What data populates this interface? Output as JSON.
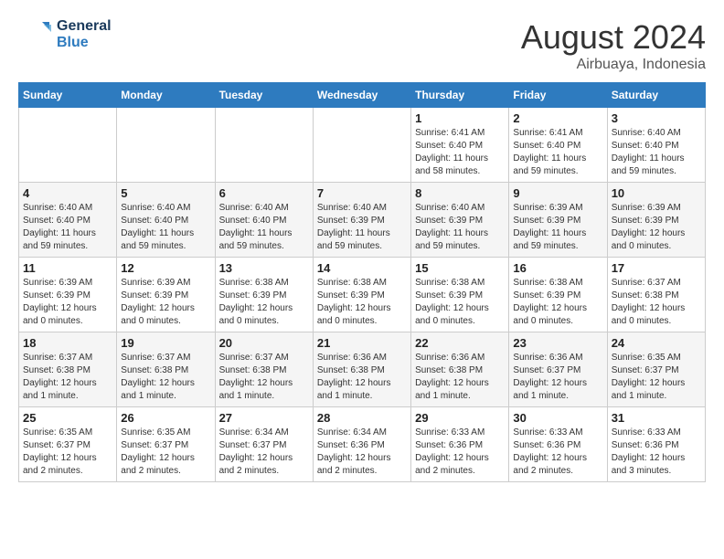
{
  "logo": {
    "line1": "General",
    "line2": "Blue"
  },
  "title": "August 2024",
  "location": "Airbuaya, Indonesia",
  "headers": [
    "Sunday",
    "Monday",
    "Tuesday",
    "Wednesday",
    "Thursday",
    "Friday",
    "Saturday"
  ],
  "weeks": [
    [
      {
        "day": "",
        "info": ""
      },
      {
        "day": "",
        "info": ""
      },
      {
        "day": "",
        "info": ""
      },
      {
        "day": "",
        "info": ""
      },
      {
        "day": "1",
        "info": "Sunrise: 6:41 AM\nSunset: 6:40 PM\nDaylight: 11 hours and 58 minutes."
      },
      {
        "day": "2",
        "info": "Sunrise: 6:41 AM\nSunset: 6:40 PM\nDaylight: 11 hours and 59 minutes."
      },
      {
        "day": "3",
        "info": "Sunrise: 6:40 AM\nSunset: 6:40 PM\nDaylight: 11 hours and 59 minutes."
      }
    ],
    [
      {
        "day": "4",
        "info": "Sunrise: 6:40 AM\nSunset: 6:40 PM\nDaylight: 11 hours and 59 minutes."
      },
      {
        "day": "5",
        "info": "Sunrise: 6:40 AM\nSunset: 6:40 PM\nDaylight: 11 hours and 59 minutes."
      },
      {
        "day": "6",
        "info": "Sunrise: 6:40 AM\nSunset: 6:40 PM\nDaylight: 11 hours and 59 minutes."
      },
      {
        "day": "7",
        "info": "Sunrise: 6:40 AM\nSunset: 6:39 PM\nDaylight: 11 hours and 59 minutes."
      },
      {
        "day": "8",
        "info": "Sunrise: 6:40 AM\nSunset: 6:39 PM\nDaylight: 11 hours and 59 minutes."
      },
      {
        "day": "9",
        "info": "Sunrise: 6:39 AM\nSunset: 6:39 PM\nDaylight: 11 hours and 59 minutes."
      },
      {
        "day": "10",
        "info": "Sunrise: 6:39 AM\nSunset: 6:39 PM\nDaylight: 12 hours and 0 minutes."
      }
    ],
    [
      {
        "day": "11",
        "info": "Sunrise: 6:39 AM\nSunset: 6:39 PM\nDaylight: 12 hours and 0 minutes."
      },
      {
        "day": "12",
        "info": "Sunrise: 6:39 AM\nSunset: 6:39 PM\nDaylight: 12 hours and 0 minutes."
      },
      {
        "day": "13",
        "info": "Sunrise: 6:38 AM\nSunset: 6:39 PM\nDaylight: 12 hours and 0 minutes."
      },
      {
        "day": "14",
        "info": "Sunrise: 6:38 AM\nSunset: 6:39 PM\nDaylight: 12 hours and 0 minutes."
      },
      {
        "day": "15",
        "info": "Sunrise: 6:38 AM\nSunset: 6:39 PM\nDaylight: 12 hours and 0 minutes."
      },
      {
        "day": "16",
        "info": "Sunrise: 6:38 AM\nSunset: 6:39 PM\nDaylight: 12 hours and 0 minutes."
      },
      {
        "day": "17",
        "info": "Sunrise: 6:37 AM\nSunset: 6:38 PM\nDaylight: 12 hours and 0 minutes."
      }
    ],
    [
      {
        "day": "18",
        "info": "Sunrise: 6:37 AM\nSunset: 6:38 PM\nDaylight: 12 hours and 1 minute."
      },
      {
        "day": "19",
        "info": "Sunrise: 6:37 AM\nSunset: 6:38 PM\nDaylight: 12 hours and 1 minute."
      },
      {
        "day": "20",
        "info": "Sunrise: 6:37 AM\nSunset: 6:38 PM\nDaylight: 12 hours and 1 minute."
      },
      {
        "day": "21",
        "info": "Sunrise: 6:36 AM\nSunset: 6:38 PM\nDaylight: 12 hours and 1 minute."
      },
      {
        "day": "22",
        "info": "Sunrise: 6:36 AM\nSunset: 6:38 PM\nDaylight: 12 hours and 1 minute."
      },
      {
        "day": "23",
        "info": "Sunrise: 6:36 AM\nSunset: 6:37 PM\nDaylight: 12 hours and 1 minute."
      },
      {
        "day": "24",
        "info": "Sunrise: 6:35 AM\nSunset: 6:37 PM\nDaylight: 12 hours and 1 minute."
      }
    ],
    [
      {
        "day": "25",
        "info": "Sunrise: 6:35 AM\nSunset: 6:37 PM\nDaylight: 12 hours and 2 minutes."
      },
      {
        "day": "26",
        "info": "Sunrise: 6:35 AM\nSunset: 6:37 PM\nDaylight: 12 hours and 2 minutes."
      },
      {
        "day": "27",
        "info": "Sunrise: 6:34 AM\nSunset: 6:37 PM\nDaylight: 12 hours and 2 minutes."
      },
      {
        "day": "28",
        "info": "Sunrise: 6:34 AM\nSunset: 6:36 PM\nDaylight: 12 hours and 2 minutes."
      },
      {
        "day": "29",
        "info": "Sunrise: 6:33 AM\nSunset: 6:36 PM\nDaylight: 12 hours and 2 minutes."
      },
      {
        "day": "30",
        "info": "Sunrise: 6:33 AM\nSunset: 6:36 PM\nDaylight: 12 hours and 2 minutes."
      },
      {
        "day": "31",
        "info": "Sunrise: 6:33 AM\nSunset: 6:36 PM\nDaylight: 12 hours and 3 minutes."
      }
    ]
  ]
}
